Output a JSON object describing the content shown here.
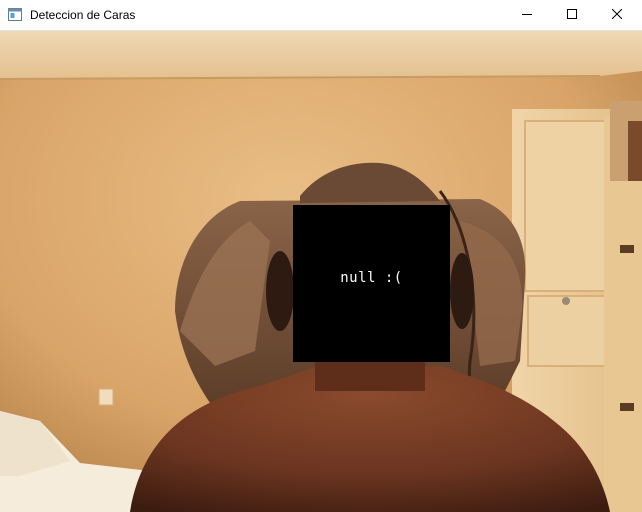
{
  "window": {
    "title": "Deteccion de Caras",
    "icon": "opencv-window-icon",
    "controls": {
      "minimize": "minimize-icon",
      "maximize": "maximize-icon",
      "close": "close-icon"
    }
  },
  "video": {
    "overlay_label": "null :(",
    "overlay_color": "#000000",
    "overlay_text_color": "#ffffff"
  }
}
